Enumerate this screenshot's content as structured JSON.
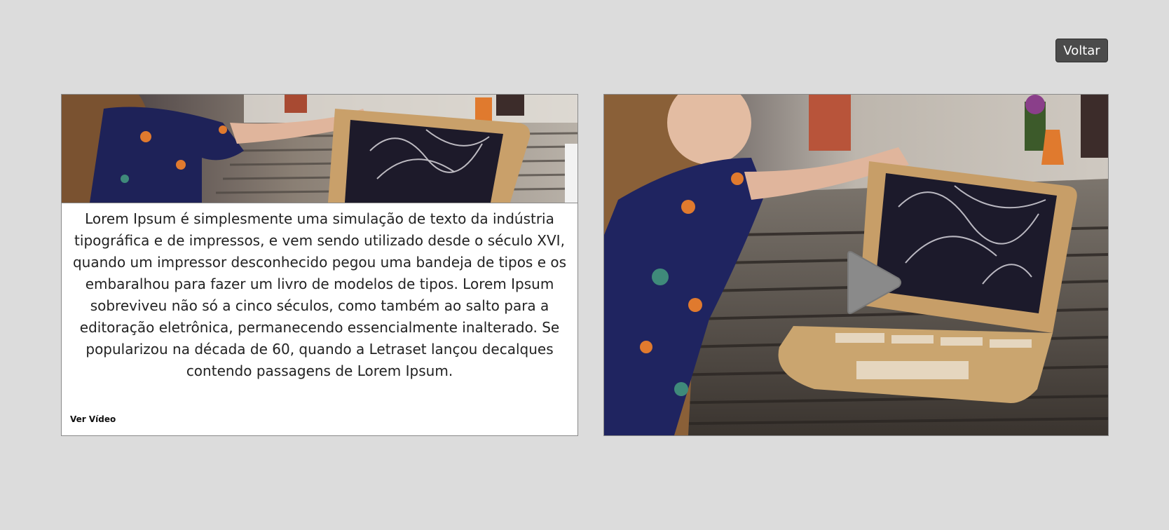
{
  "header": {
    "back_label": "Voltar"
  },
  "card": {
    "image_icon": "photo-child-cardboard-laptop",
    "body_text": "Lorem Ipsum é simplesmente uma simulação de texto da indústria tipográfica e de impressos, e vem sendo utilizado desde o século XVI, quando um impressor desconhecido pegou uma bandeja de tipos e os embaralhou para fazer um livro de modelos de tipos. Lorem Ipsum sobreviveu não só a cinco séculos, como também ao salto para a editoração eletrônica, permanecendo essencialmente inalterado. Se popularizou na década de 60, quando a Letraset lançou decalques contendo passagens de Lorem Ipsum.",
    "link_label": "Ver Vídeo"
  },
  "video": {
    "thumbnail_icon": "photo-child-cardboard-laptop",
    "play_icon": "play-icon"
  },
  "colors": {
    "page_background": "#dcdcdc",
    "button_background": "#4b4b4b",
    "card_border": "#8a8a8a"
  }
}
